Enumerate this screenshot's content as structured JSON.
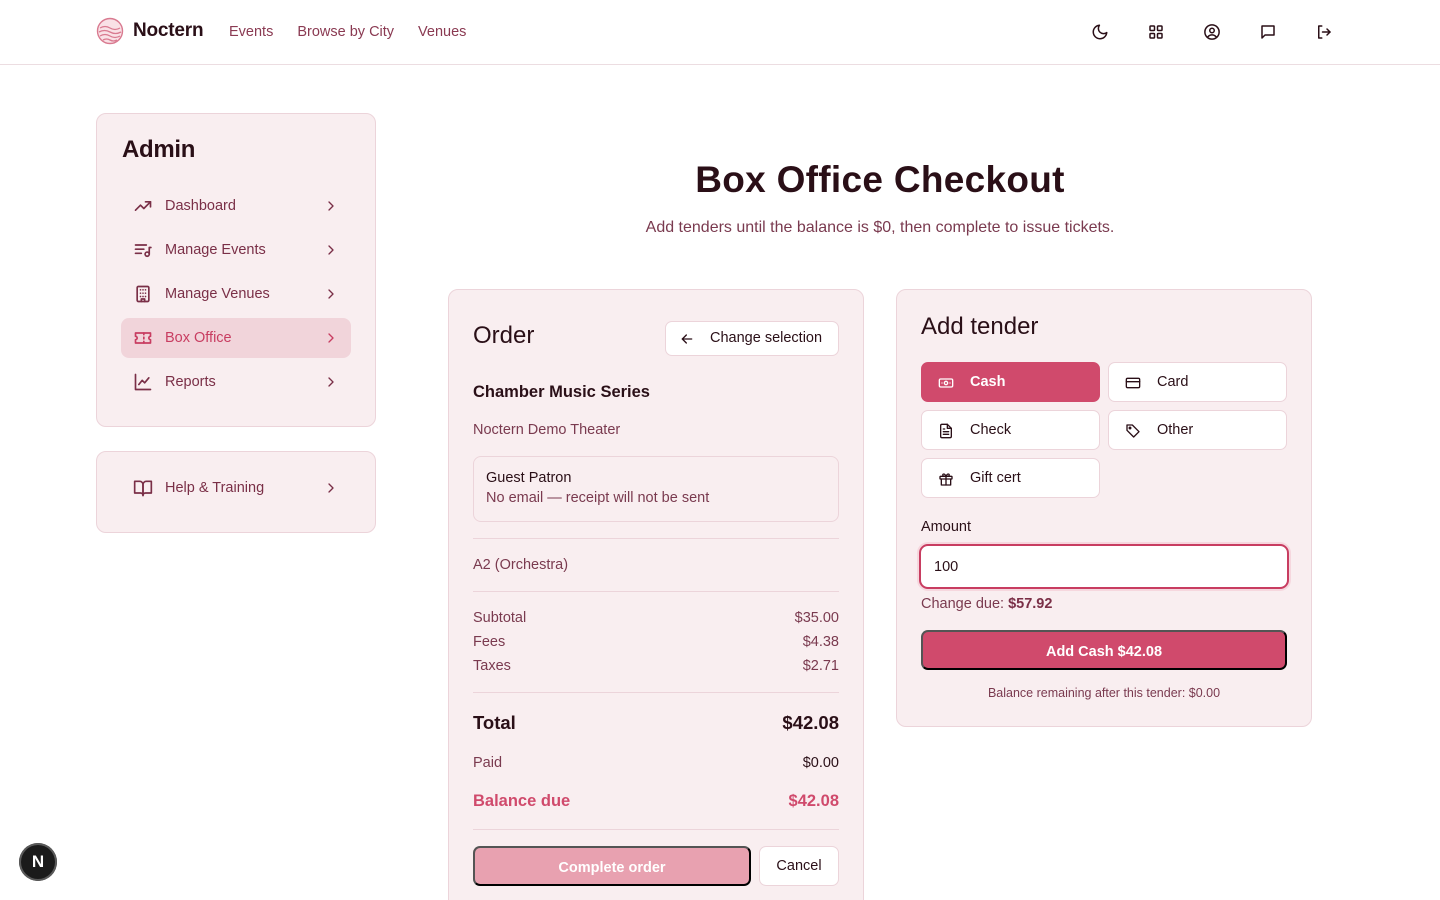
{
  "header": {
    "brand": "Noctern",
    "nav": [
      "Events",
      "Browse by City",
      "Venues"
    ],
    "icons": [
      "moon-icon",
      "grid-icon",
      "user-circle-icon",
      "message-icon",
      "logout-icon"
    ]
  },
  "sidebar": {
    "title": "Admin",
    "items": [
      {
        "label": "Dashboard",
        "icon": "trending-up-icon",
        "active": false
      },
      {
        "label": "Manage Events",
        "icon": "list-music-icon",
        "active": false
      },
      {
        "label": "Manage Venues",
        "icon": "building-icon",
        "active": false
      },
      {
        "label": "Box Office",
        "icon": "ticket-icon",
        "active": true
      },
      {
        "label": "Reports",
        "icon": "line-chart-icon",
        "active": false
      }
    ],
    "help": {
      "label": "Help & Training",
      "icon": "book-open-icon"
    }
  },
  "page": {
    "title": "Box Office Checkout",
    "subtitle": "Add tenders until the balance is $0, then complete to issue tickets."
  },
  "order": {
    "title": "Order",
    "change_selection": "Change selection",
    "event": "Chamber Music Series",
    "venue": "Noctern Demo Theater",
    "patron_name": "Guest Patron",
    "patron_note": "No email — receipt will not be sent",
    "seat": "A2 (Orchestra)",
    "subtotal_label": "Subtotal",
    "subtotal": "$35.00",
    "fees_label": "Fees",
    "fees": "$4.38",
    "taxes_label": "Taxes",
    "taxes": "$2.71",
    "total_label": "Total",
    "total": "$42.08",
    "paid_label": "Paid",
    "paid": "$0.00",
    "balance_label": "Balance due",
    "balance": "$42.08",
    "complete_label": "Complete order",
    "cancel_label": "Cancel"
  },
  "tender": {
    "title": "Add tender",
    "options": [
      {
        "label": "Cash",
        "icon": "banknote-icon",
        "selected": true
      },
      {
        "label": "Card",
        "icon": "credit-card-icon",
        "selected": false
      },
      {
        "label": "Check",
        "icon": "file-text-icon",
        "selected": false
      },
      {
        "label": "Other",
        "icon": "tag-icon",
        "selected": false
      },
      {
        "label": "Gift cert",
        "icon": "gift-icon",
        "selected": false
      }
    ],
    "amount_label": "Amount",
    "amount_value": "100",
    "change_due_label": "Change due:",
    "change_due": "$57.92",
    "add_button": "Add Cash $42.08",
    "balance_after": "Balance remaining after this tender: $0.00"
  },
  "badge": {
    "letter": "N"
  },
  "colors": {
    "accent": "#d04a6c",
    "accent_light": "#e8a1b0",
    "card_bg": "#f9eef0",
    "border": "#ecd4da",
    "active_bg": "#f1d4da",
    "text": "#2a0f17",
    "muted": "#7a3a4f"
  }
}
